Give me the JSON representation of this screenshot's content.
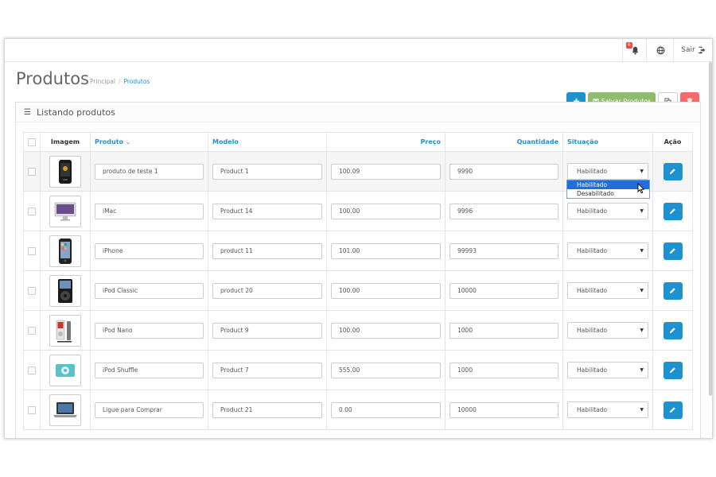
{
  "topbar": {
    "notifications_count": "6",
    "logout_label": "Sair"
  },
  "header": {
    "title": "Produtos",
    "breadcrumb": [
      "Principal",
      "Produtos"
    ],
    "save_label": "Salvar Produtos"
  },
  "panel": {
    "title": "Listando produtos"
  },
  "table": {
    "columns": {
      "image": "Imagem",
      "product": "Produto",
      "model": "Modelo",
      "price": "Preço",
      "quantity": "Quantidade",
      "status": "Situação",
      "action": "Ação"
    },
    "rows": [
      {
        "name": "produto de teste 1",
        "model": "Product 1",
        "price": "100.09",
        "quantity": "9990",
        "status": "Habilitado",
        "image": "black-phone"
      },
      {
        "name": "iMac",
        "model": "Product 14",
        "price": "100.00",
        "quantity": "9996",
        "status": "Habilitado",
        "image": "imac"
      },
      {
        "name": "iPhone",
        "model": "product 11",
        "price": "101.00",
        "quantity": "99993",
        "status": "Habilitado",
        "image": "iphone"
      },
      {
        "name": "iPod Classic",
        "model": "product 20",
        "price": "100.00",
        "quantity": "10000",
        "status": "Habilitado",
        "image": "ipod-classic"
      },
      {
        "name": "iPod Nano",
        "model": "Product 9",
        "price": "100.00",
        "quantity": "1000",
        "status": "Habilitado",
        "image": "ipod-nano"
      },
      {
        "name": "iPod Shuffle",
        "model": "Product 7",
        "price": "555.00",
        "quantity": "1000",
        "status": "Habilitado",
        "image": "ipod-shuffle"
      },
      {
        "name": "Ligue para Comprar",
        "model": "Product 21",
        "price": "0.00",
        "quantity": "10000",
        "status": "Habilitado",
        "image": "laptop"
      }
    ]
  },
  "dropdown": {
    "options": [
      "Habilitado",
      "Desabilitado"
    ]
  },
  "colors": {
    "primary": "#1e91cf",
    "success": "#8fbb6c",
    "danger": "#f56b6b"
  }
}
